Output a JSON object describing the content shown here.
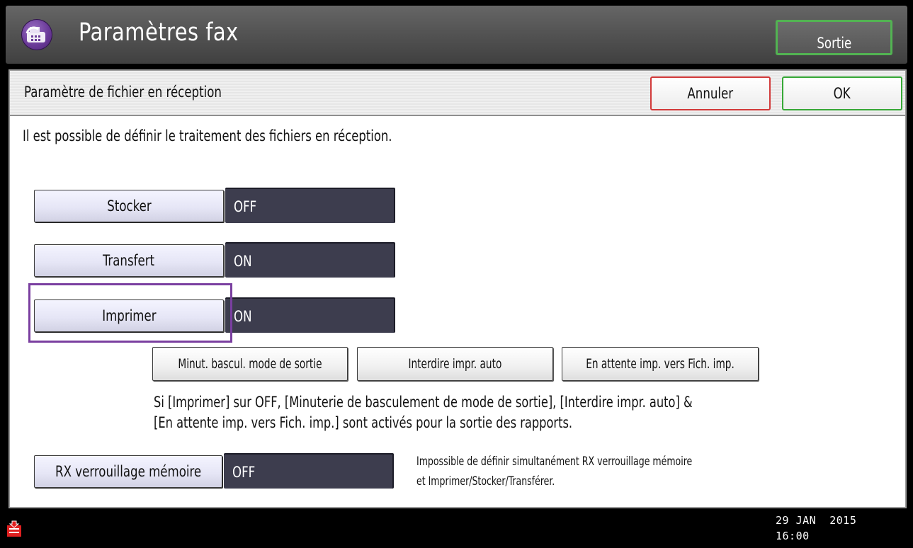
{
  "header": {
    "title": "Paramètres fax",
    "exit_label": "Sortie"
  },
  "subheader": {
    "title": "Paramètre de fichier en réception",
    "cancel_label": "Annuler",
    "ok_label": "OK"
  },
  "intro": "Il est possible de définir le traitement des fichiers en réception.",
  "settings": [
    {
      "label": "Stocker",
      "value": "OFF"
    },
    {
      "label": "Transfert",
      "value": "ON"
    },
    {
      "label": "Imprimer",
      "value": "ON"
    }
  ],
  "print_options": [
    "Minut. bascul. mode de sortie",
    "Interdire impr. auto",
    "En attente imp. vers Fich. imp."
  ],
  "print_note": {
    "line1": "Si [Imprimer] sur OFF, [Minuterie de basculement de mode de sortie], [Interdire impr. auto] &",
    "line2": "[En attente imp. vers Fich. imp.] sont activés pour la sortie des rapports."
  },
  "memory_lock": {
    "label": "RX verrouillage mémoire",
    "value": "OFF",
    "note_line1": "Impossible de définir simultanément RX verrouillage mémoire",
    "note_line2": "et Imprimer/Stocker/Transférer."
  },
  "footer": {
    "date": "29 JAN  2015",
    "time": "16:00",
    "status_icon": "inbox-tray-icon"
  },
  "colors": {
    "header_bg": "#545454",
    "exit_border": "#52b352",
    "cancel_border": "#d23a3a",
    "ok_border": "#36a836",
    "value_bg": "#3d3d4e",
    "highlight": "#7a3fa0"
  }
}
